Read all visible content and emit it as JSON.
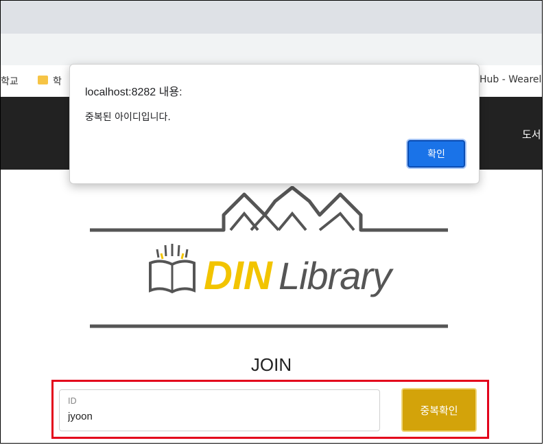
{
  "bookmarks": [
    {
      "label": "학교"
    },
    {
      "label": "학"
    },
    {
      "label": "Hub - Wearel"
    }
  ],
  "nav": {
    "item_label": "도서"
  },
  "logo": {
    "part1": "DIN",
    "part2": "Library",
    "accent": "#f2c400",
    "text_color": "#555555"
  },
  "join": {
    "title": "JOIN",
    "id_label": "ID",
    "id_value": "jyoon",
    "check_button": "중복확인"
  },
  "dialog": {
    "title": "localhost:8282 내용:",
    "message": "중복된 아이디입니다.",
    "ok_label": "확인"
  },
  "colors": {
    "highlight": "#e3001b",
    "button": "#d3a30a",
    "dialog_button": "#1a73e8"
  }
}
